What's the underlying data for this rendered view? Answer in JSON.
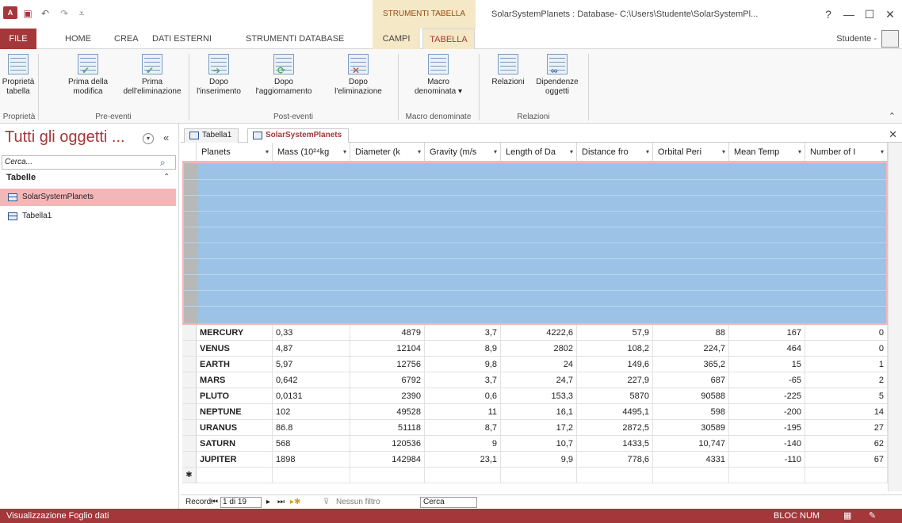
{
  "titlebar": {
    "app_icon": "A",
    "context_label": "STRUMENTI TABELLA",
    "window_title": "SolarSystemPlanets : Database- C:\\Users\\Studente\\SolarSystemPl...",
    "help": "?",
    "min": "—",
    "max": "☐",
    "close": "✕"
  },
  "tabs": {
    "file": "FILE",
    "home": "HOME",
    "crea": "CREA",
    "dati_esterni": "DATI ESTERNI",
    "strumenti_db": "STRUMENTI DATABASE",
    "campi": "CAMPI",
    "tabella": "TABELLA",
    "user": "Studente -"
  },
  "ribbon": {
    "buttons": [
      {
        "line1": "Proprietà",
        "line2": "tabella"
      },
      {
        "line1": "Prima della",
        "line2": "modifica"
      },
      {
        "line1": "Prima",
        "line2": "dell'eliminazione"
      },
      {
        "line1": "Dopo",
        "line2": "l'inserimento"
      },
      {
        "line1": "Dopo",
        "line2": "l'aggiornamento"
      },
      {
        "line1": "Dopo",
        "line2": "l'eliminazione"
      },
      {
        "line1": "Macro",
        "line2": "denominata ▾"
      },
      {
        "line1": "Relazioni",
        "line2": ""
      },
      {
        "line1": "Dipendenze",
        "line2": "oggetti"
      }
    ],
    "groups": [
      "Proprietà",
      "Pre-eventi",
      "Post-eventi",
      "Macro denominate",
      "Relazioni"
    ]
  },
  "nav": {
    "title": "Tutti gli oggetti ...",
    "search_placeholder": "Cerca...",
    "section": "Tabelle",
    "items": [
      "SolarSystemPlanets",
      "Tabella1"
    ]
  },
  "doc_tabs": [
    "Tabella1",
    "SolarSystemPlanets"
  ],
  "table": {
    "columns": [
      "Planets",
      "Mass (10²⁴kg",
      "Diameter (k",
      "Gravity (m/s",
      "Length of Da",
      "Distance fro",
      "Orbital Peri",
      "Mean Temp",
      "Number of I"
    ],
    "rows": [
      [
        "MERCURY",
        "0,33",
        "4879",
        "3,7",
        "4222,6",
        "57,9",
        "88",
        "167",
        "0"
      ],
      [
        "VENUS",
        "4,87",
        "12104",
        "8,9",
        "2802",
        "108,2",
        "224,7",
        "464",
        "0"
      ],
      [
        "EARTH",
        "5,97",
        "12756",
        "9,8",
        "24",
        "149,6",
        "365,2",
        "15",
        "1"
      ],
      [
        "MARS",
        "0,642",
        "6792",
        "3,7",
        "24,7",
        "227,9",
        "687",
        "-65",
        "2"
      ],
      [
        "PLUTO",
        "0,0131",
        "2390",
        "0,6",
        "153,3",
        "5870",
        "90588",
        "-225",
        "5"
      ],
      [
        "NEPTUNE",
        "102",
        "49528",
        "11",
        "16,1",
        "4495,1",
        "598",
        "-200",
        "14"
      ],
      [
        "URANUS",
        "86.8",
        "51118",
        "8,7",
        "17,2",
        "2872,5",
        "30589",
        "-195",
        "27"
      ],
      [
        "SATURN",
        "568",
        "120536",
        "9",
        "10,7",
        "1433,5",
        "10,747",
        "-140",
        "62"
      ],
      [
        "JUPITER",
        "1898",
        "142984",
        "23,1",
        "9,9",
        "778,6",
        "4331",
        "-110",
        "67"
      ]
    ],
    "new_row_marker": "✱"
  },
  "recnav": {
    "label": "Record:",
    "position": "1 di 19",
    "filter": "Nessun filtro",
    "search": "Cerca"
  },
  "status": {
    "view": "Visualizzazione Foglio dati",
    "numlock": "BLOC NUM"
  }
}
